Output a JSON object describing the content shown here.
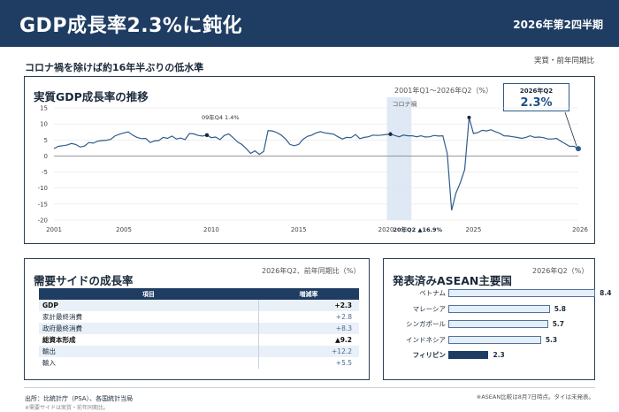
{
  "header": {
    "title": "GDP成長率2.3%に鈍化",
    "period": "2026年第2四半期"
  },
  "subheadline": "コロナ禍を除けば約16年半ぶりの低水準",
  "basis_note": "実質・前年同期比",
  "main_chart": {
    "title": "実質GDP成長率の推移",
    "range_note": "2001年Q1〜2026年Q2（%）",
    "callout_label": "2026年Q2",
    "callout_value": "2.3%",
    "covid_label": "コロナ禍",
    "ann_2009": "09年Q4 1.4%",
    "ann_2020": "20年Q2",
    "ann_2020_value": "▲16.9%"
  },
  "chart_data": [
    {
      "type": "line",
      "title": "実質GDP成長率の推移",
      "xlabel": "",
      "ylabel": "",
      "ylim": [
        -20,
        15
      ],
      "yticks": [
        "-20",
        "-15",
        "-10",
        "-5",
        "0",
        "5",
        "10",
        "15"
      ],
      "xticks": [
        "2001",
        "2005",
        "2010",
        "2015",
        "2020",
        "2025",
        "2026"
      ],
      "grid": true,
      "highlight_band": "2020Q2-2021Q2",
      "series": [
        {
          "values": [
            2.3,
            3.0,
            3.2,
            3.4,
            3.9,
            3.6,
            2.8,
            3.1,
            4.2,
            4.0,
            4.6,
            4.8,
            4.9,
            5.2,
            6.3,
            6.8,
            7.2,
            7.5,
            6.5,
            5.8,
            5.4,
            5.5,
            4.2,
            4.7,
            4.8,
            5.8,
            5.5,
            6.2,
            5.3,
            5.6,
            5.1,
            7.0,
            6.9,
            6.4,
            6.2,
            6.5,
            5.7,
            5.9,
            5.1,
            6.4,
            6.9,
            5.7,
            4.4,
            3.6,
            2.3,
            0.8,
            1.6,
            0.5,
            1.4,
            7.9,
            7.8,
            7.3,
            6.5,
            5.3,
            3.6,
            3.2,
            3.6,
            5.2,
            6.1,
            6.5,
            7.2,
            7.6,
            7.2,
            7.0,
            6.8,
            6.0,
            5.3,
            5.8,
            5.7,
            6.7,
            5.4,
            5.8,
            6.0,
            6.5,
            6.4,
            6.5,
            6.7,
            6.8,
            6.4,
            6.0,
            6.5,
            6.3,
            6.3,
            6.0,
            6.3,
            5.9,
            6.0,
            6.4,
            6.2,
            6.3,
            0.7,
            -16.9,
            -11.6,
            -8.3,
            -4.2,
            12.0,
            7.0,
            7.3,
            8.0,
            7.8,
            8.2,
            7.6,
            7.1,
            6.3,
            6.2,
            6.0,
            5.8,
            5.5,
            5.8,
            6.3,
            5.8,
            5.9,
            5.7,
            5.3,
            5.3,
            5.5,
            4.6,
            3.8,
            3.0,
            3.0,
            2.3
          ]
        }
      ]
    },
    {
      "type": "bar",
      "title": "発表済みASEAN主要国",
      "categories": [
        "ベトナム",
        "マレーシア",
        "シンガポール",
        "インドネシア",
        "フィリピン"
      ],
      "values": [
        8.4,
        5.8,
        5.7,
        5.3,
        2.3
      ],
      "highlight": "フィリピン",
      "xlim": [
        0,
        9
      ]
    }
  ],
  "demand_table": {
    "title": "需要サイドの成長率",
    "note": "2026年Q2、前年同期比（%）",
    "col_item": "項目",
    "col_rate": "増減率",
    "rows": [
      {
        "item": "GDP",
        "value": "+2.3"
      },
      {
        "item": "家計最終消費",
        "value": "+2.8"
      },
      {
        "item": "政府最終消費",
        "value": "+8.3"
      },
      {
        "item": "総資本形成",
        "value": "▲9.2"
      },
      {
        "item": "輸出",
        "value": "+12.2"
      },
      {
        "item": "輸入",
        "value": "+5.5"
      }
    ]
  },
  "asean": {
    "title": "発表済みASEAN主要国",
    "note": "2026年Q2（%）",
    "labels": [
      "ベトナム",
      "マレーシア",
      "シンガポール",
      "インドネシア",
      "フィリピン"
    ],
    "values": [
      "8.4",
      "5.8",
      "5.7",
      "5.3",
      "2.3"
    ]
  },
  "footer": {
    "source": "出所：比統計庁（PSA）、各国統計当局",
    "source_note": "※需要サイドは実質・前年同期比。",
    "right_note": "※ASEAN比較は8月7日時点。タイは未発表。"
  },
  "colors": {
    "navy": "#1f3d63",
    "line": "#2f5d8c",
    "band": "#dfe9f5"
  }
}
